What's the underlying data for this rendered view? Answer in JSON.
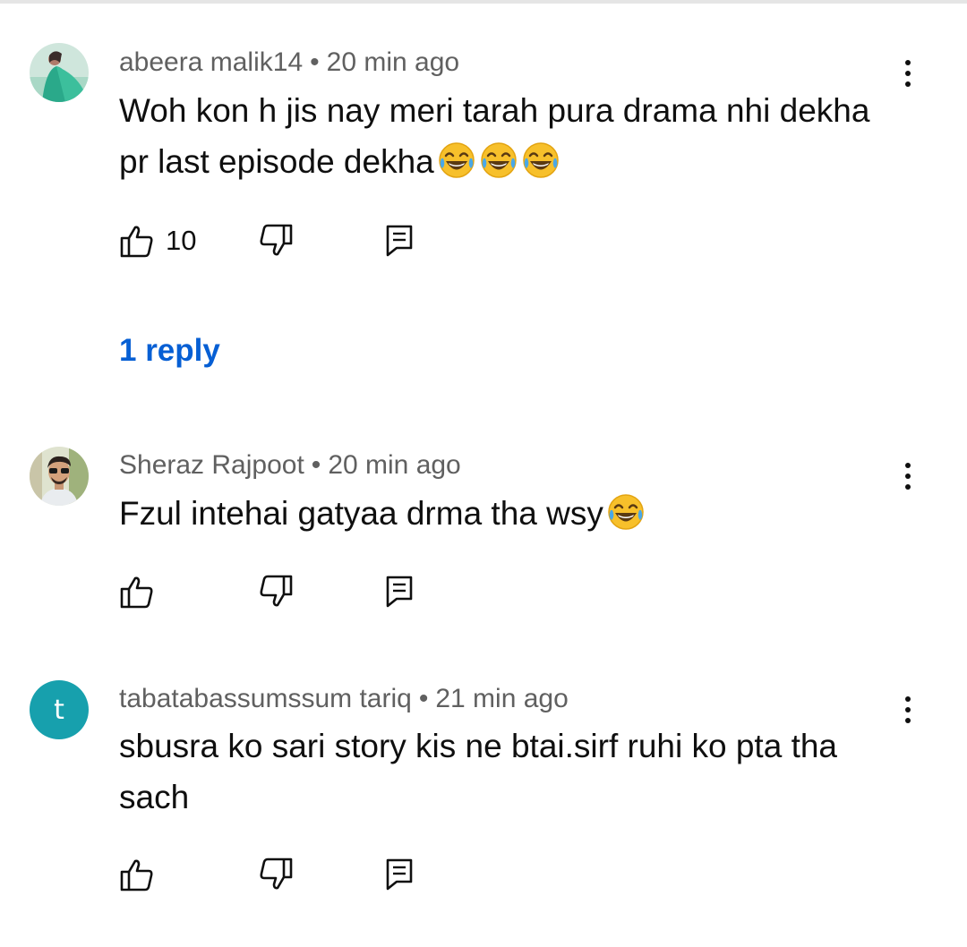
{
  "comments": [
    {
      "author": "abeera malik14",
      "separator": "•",
      "time": "20 min ago",
      "text": "Woh kon h jis nay meri tarah pura drama nhi dekha pr last episode dekha",
      "likes": "10",
      "replies": "1 reply",
      "avatar_icon": "profile-photo-green"
    },
    {
      "author": "Sheraz Rajpoot",
      "separator": "•",
      "time": "20 min ago",
      "text": "Fzul intehai gatyaa drma tha wsy",
      "avatar_icon": "profile-photo-man-sunglasses"
    },
    {
      "author": "tabatabassumssum tariq",
      "separator": "•",
      "time": "21 min ago",
      "text": "sbusra ko sari story kis ne btai.sirf ruhi ko pta tha sach",
      "avatar_letter": "t"
    }
  ],
  "icons": {
    "like": "thumbs-up-icon",
    "dislike": "thumbs-down-icon",
    "reply": "reply-icon",
    "more": "more-vert-icon",
    "emoji": "face-with-tears-of-joy"
  },
  "colors": {
    "link": "#065fd4",
    "meta": "#606060",
    "letter_avatar_bg": "#17a0ad"
  }
}
